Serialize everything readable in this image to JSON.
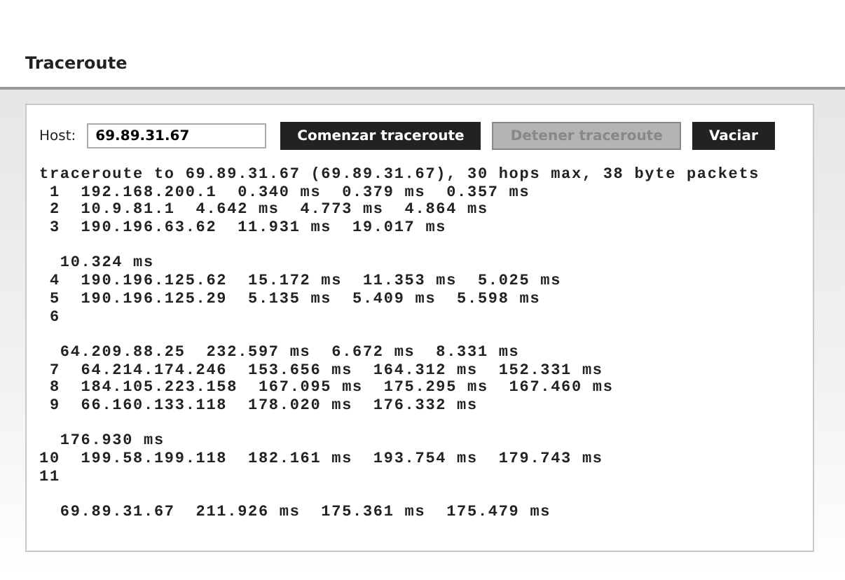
{
  "page": {
    "title": "Traceroute"
  },
  "form": {
    "host_label": "Host:",
    "host_value": "69.89.31.67",
    "buttons": [
      {
        "label": "Comenzar traceroute",
        "disabled": false
      },
      {
        "label": "Detener traceroute",
        "disabled": true
      },
      {
        "label": "Vaciar",
        "disabled": false
      }
    ]
  },
  "output": {
    "blocks": [
      [
        "traceroute to 69.89.31.67 (69.89.31.67), 30 hops max, 38 byte packets",
        " 1  192.168.200.1  0.340 ms  0.379 ms  0.357 ms",
        " 2  10.9.81.1  4.642 ms  4.773 ms  4.864 ms",
        " 3  190.196.63.62  11.931 ms  19.017 ms"
      ],
      [
        "  10.324 ms",
        " 4  190.196.125.62  15.172 ms  11.353 ms  5.025 ms",
        " 5  190.196.125.29  5.135 ms  5.409 ms  5.598 ms",
        " 6"
      ],
      [
        "  64.209.88.25  232.597 ms  6.672 ms  8.331 ms",
        " 7  64.214.174.246  153.656 ms  164.312 ms  152.331 ms",
        " 8  184.105.223.158  167.095 ms  175.295 ms  167.460 ms",
        " 9  66.160.133.118  178.020 ms  176.332 ms"
      ],
      [
        "  176.930 ms",
        "10  199.58.199.118  182.161 ms  193.754 ms  179.743 ms",
        "11"
      ],
      [
        "  69.89.31.67  211.926 ms  175.361 ms  175.479 ms"
      ]
    ]
  }
}
